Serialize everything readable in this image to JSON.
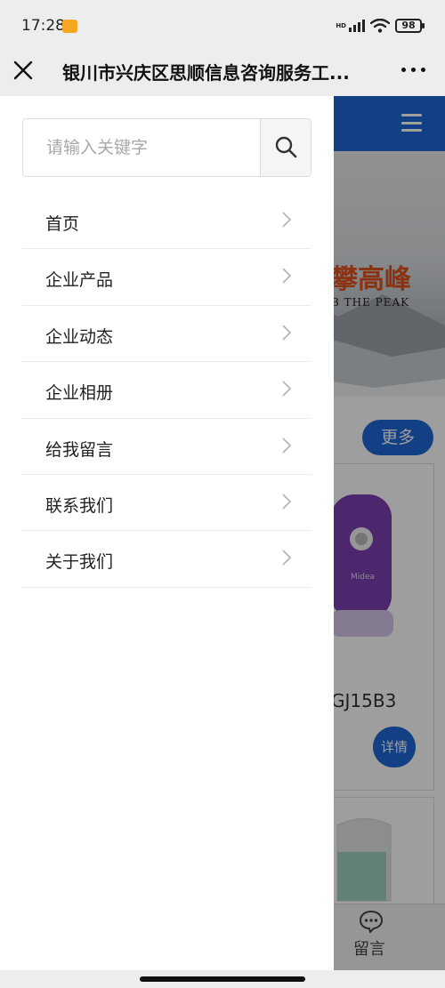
{
  "status_bar": {
    "time": "17:28",
    "hd": "HD",
    "battery": "98"
  },
  "header": {
    "title": "银川市兴庆区思顺信息咨询服务工..."
  },
  "background": {
    "banner_text": "攀高峰",
    "banner_sub": "B THE PEAK",
    "more_label": "更多",
    "product_model": "GJ15B3",
    "detail_label": "详情",
    "message_label": "留言",
    "product_brand": "Midea"
  },
  "drawer": {
    "search": {
      "placeholder": "请输入关键字",
      "value": ""
    },
    "menu": [
      {
        "label": "首页"
      },
      {
        "label": "企业产品"
      },
      {
        "label": "企业动态"
      },
      {
        "label": "企业相册"
      },
      {
        "label": "给我留言"
      },
      {
        "label": "联系我们"
      },
      {
        "label": "关于我们"
      }
    ]
  },
  "colors": {
    "accent": "#1f66d6",
    "overlay": "rgba(0,0,0,0.38)",
    "header_bg": "#ededed"
  }
}
